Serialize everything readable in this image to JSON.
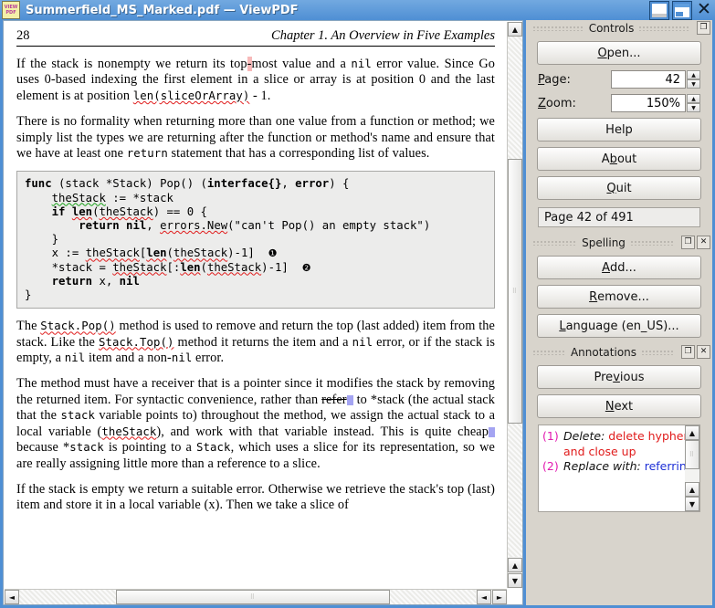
{
  "window": {
    "title": "Summerfield_MS_Marked.pdf — ViewPDF",
    "icon": "pdf-document-icon",
    "icon_line1": "VIEW",
    "icon_line2": "PDF",
    "minimize_label": "_",
    "maximize_label": "□",
    "close_label": "✕"
  },
  "document": {
    "page_number": "28",
    "chapter": "Chapter 1. An Overview in Five Examples",
    "paragraph1": {
      "a": "If the stack is nonempty we return its top",
      "hl": "-",
      "b": "most value and a ",
      "mono1": "nil",
      "c": " error value. Since Go uses 0-based indexing the first element in a slice or array is at position 0 and the last element is at position ",
      "mono2": "len(sliceOrArray)",
      "d": " - 1."
    },
    "paragraph2": {
      "a": "There is no formality when returning more than one value from a function or method; we simply list the types we are returning after the function or method's name and ensure that we have at least one ",
      "mono1": "return",
      "b": " statement that has a corresponding list of values."
    },
    "code": {
      "line1_a": "func",
      "line1_b": " (stack *Stack) Pop() (",
      "line1_c": "interface{}",
      "line1_d": ", ",
      "line1_e": "error",
      "line1_f": ") {",
      "line2_ind": "    ",
      "line2_a": "theStack",
      "line2_b": " := *stack",
      "line3_ind": "    ",
      "line3_if": "if ",
      "line3_len": "len",
      "line3_a": "(",
      "line3_b": "theStack",
      "line3_c": ") == 0 {",
      "line4_ind": "        ",
      "line4_a": "return nil",
      "line4_b": ", ",
      "line4_c": "errors.New",
      "line4_d": "(\"can't Pop() an empty stack\")",
      "line5": "    }",
      "line6_ind": "    ",
      "line6_a": "x := ",
      "line6_b": "theStack",
      "line6_c": "[",
      "line6_len": "len",
      "line6_d": "(",
      "line6_e": "theStack",
      "line6_f": ")-1]",
      "line6_mark": "❶",
      "line7_ind": "    ",
      "line7_a": "*stack = ",
      "line7_b": "theStack",
      "line7_c": "[:",
      "line7_len": "len",
      "line7_d": "(",
      "line7_e": "theStack",
      "line7_f": ")-1]",
      "line7_mark": "❷",
      "line8_ind": "    ",
      "line8_a": "return",
      "line8_b": " x, ",
      "line8_c": "nil",
      "line9": "}"
    },
    "paragraph3": {
      "a": "The ",
      "mono1": "Stack.Pop()",
      "b": " method is used to remove and return the top (last added) item from the stack.  Like the ",
      "mono2": "Stack.Top()",
      "c": " method it returns the item and a ",
      "mono3": "nil",
      "d": " error, or if the stack is empty, a ",
      "mono4": "nil",
      "e": " item and a non-",
      "mono5": "nil",
      "f": " error."
    },
    "paragraph4": {
      "a": "The method must have a receiver that is a pointer since it modifies the stack by removing the returned item.  For syntactic convenience, rather than ",
      "strike": "refer",
      "b": " to *stack (the actual stack that the ",
      "mono1": "stack",
      "c": " variable points to) throughout the method, we assign the actual stack to a local variable (",
      "mono2": "theStack",
      "d": "), and work with that variable instead.  This is quite cheap",
      "e": " because *",
      "mono3": "stack",
      "f": " is pointing to a ",
      "mono4": "Stack",
      "g": ", which uses a slice for its representation, so we are really assigning little more than a reference to a slice."
    },
    "paragraph5": {
      "a": "If the stack is empty we return a suitable error.  Otherwise we retrieve the stack's top (last) item and store it in a local variable (x). Then we take a slice of"
    }
  },
  "controls_panel": {
    "title": "Controls",
    "float_icon": "float-panel-icon",
    "open_button": "Open...",
    "open_accel": "O",
    "page_label": "Page:",
    "page_accel": "P",
    "page_value": "42",
    "zoom_label": "Zoom:",
    "zoom_accel": "Z",
    "zoom_value": "150%",
    "help_button": "Help",
    "about_button": "About",
    "about_accel": "b",
    "quit_button": "Quit",
    "quit_accel": "Q",
    "status": "Page 42 of 491",
    "spin_up": "▲",
    "spin_down": "▼"
  },
  "spelling_panel": {
    "title": "Spelling",
    "float_icon": "float-panel-icon",
    "close_icon": "close-panel-icon",
    "add_button": "Add...",
    "add_accel": "A",
    "remove_button": "Remove...",
    "remove_accel": "R",
    "language_button": "Language (en_US)...",
    "language_accel": "L"
  },
  "annotations_panel": {
    "title": "Annotations",
    "float_icon": "float-panel-icon",
    "close_icon": "close-panel-icon",
    "previous_button": "Previous",
    "previous_accel": "v",
    "next_button": "Next",
    "next_accel": "N",
    "items": [
      {
        "num": "(1)",
        "label": "Delete:",
        "text": "delete hyphen and close up",
        "color": "#e01b1b"
      },
      {
        "num": "(2)",
        "label": "Replace with:",
        "text": "referring",
        "color": "#1d2fd6"
      }
    ]
  },
  "scrollbars": {
    "up_arrow": "▲",
    "down_arrow": "▼",
    "left_arrow": "◄",
    "right_arrow": "►"
  },
  "colors": {
    "titlebar": "#4f8fd4",
    "spell_underline": "#e01b1b",
    "grammar_underline": "#16a016",
    "highlight": "#f7b9b9",
    "annotation_number": "#e21ab0",
    "delete_text": "#e01b1b",
    "replace_text": "#1d2fd6"
  }
}
